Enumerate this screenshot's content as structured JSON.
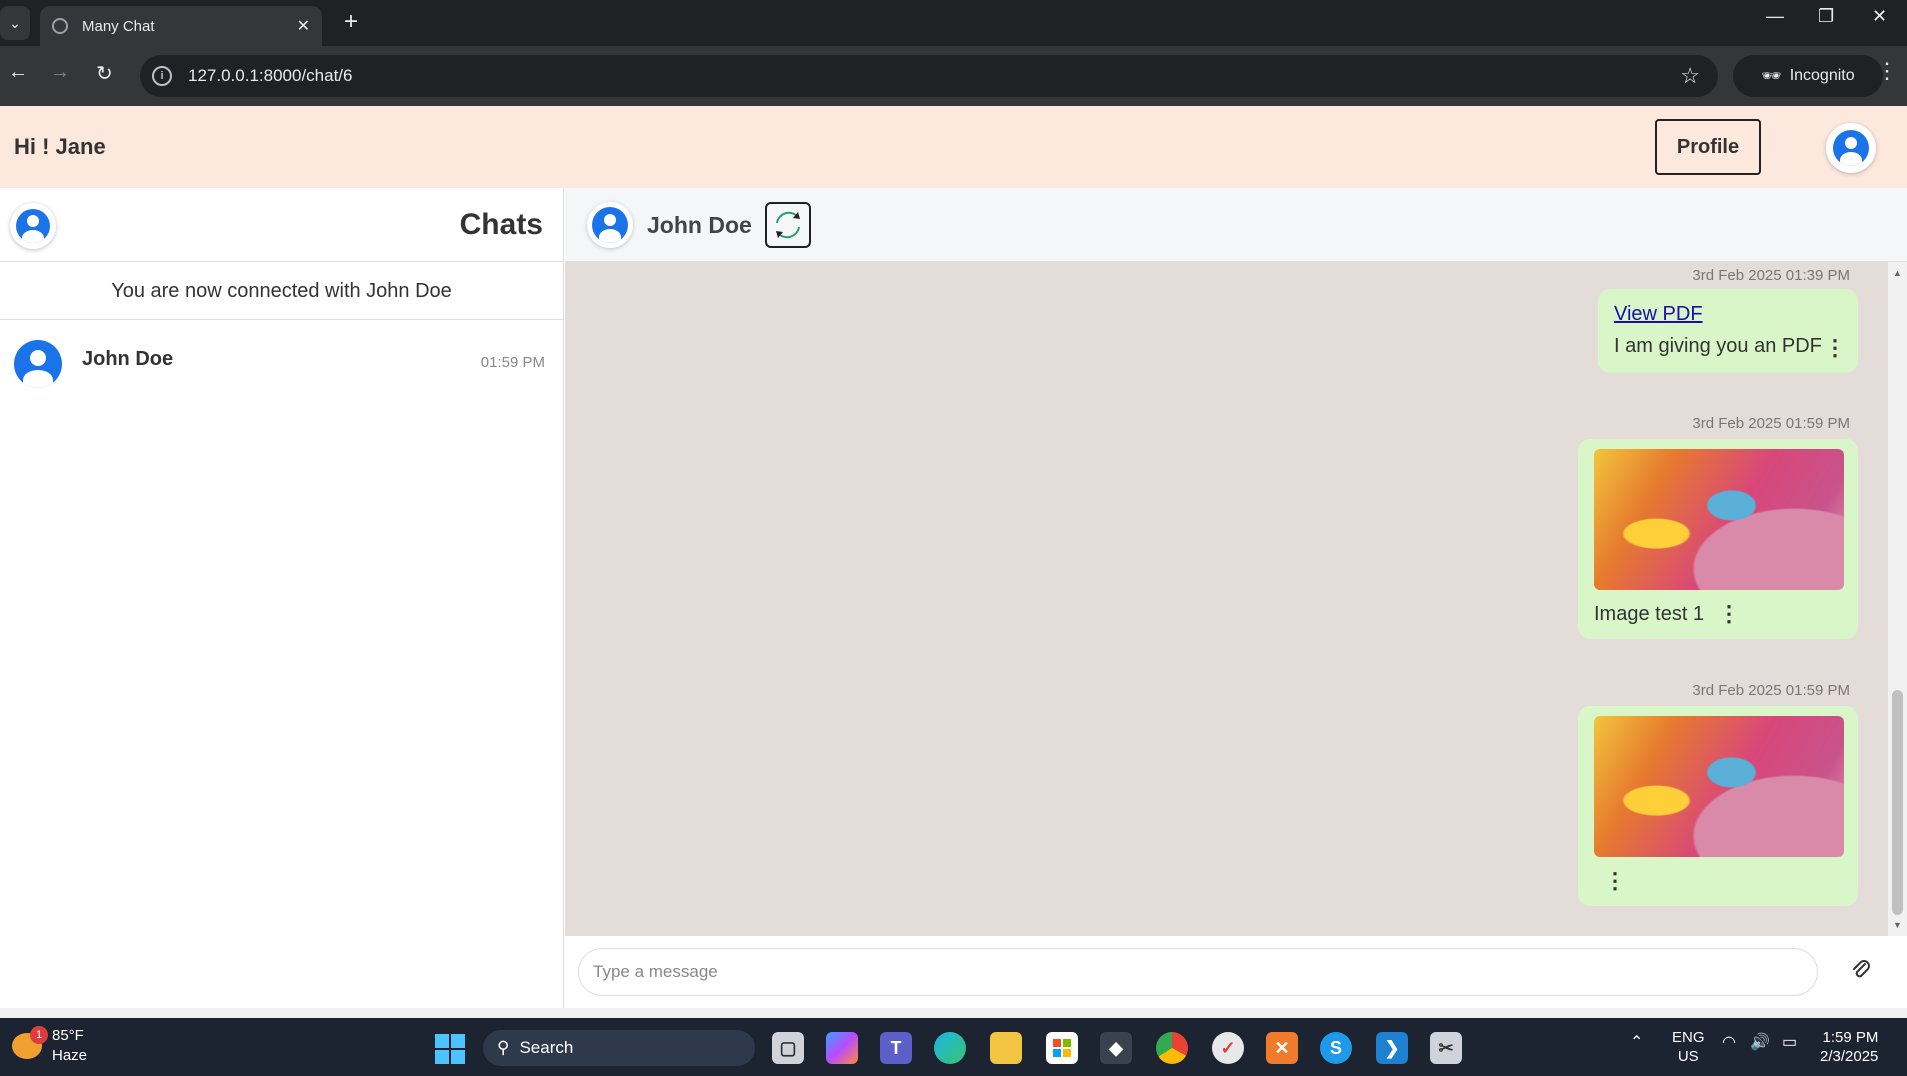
{
  "browser": {
    "tab_title": "Many Chat",
    "url": "127.0.0.1:8000/chat/6",
    "incognito_label": "Incognito"
  },
  "header": {
    "greeting": "Hi ! Jane",
    "profile_label": "Profile"
  },
  "sidebar": {
    "title": "Chats",
    "connected_message": "You are now connected with John Doe",
    "chats": [
      {
        "name": "John Doe",
        "time": "01:59 PM"
      }
    ]
  },
  "chat": {
    "contact_name": "John Doe",
    "messages": [
      {
        "timestamp": "3rd Feb 2025 01:39 PM",
        "link": "View PDF",
        "text": "I am giving you an PDF"
      },
      {
        "timestamp": "3rd Feb 2025 01:59 PM",
        "image": "chameleon",
        "text": "Image test 1"
      },
      {
        "timestamp": "3rd Feb 2025 01:59 PM",
        "image": "chameleon",
        "text": ""
      }
    ],
    "input_placeholder": "Type a message"
  },
  "taskbar": {
    "weather_temp": "85°F",
    "weather_desc": "Haze",
    "weather_badge": "1",
    "search_label": "Search",
    "lang_top": "ENG",
    "lang_bottom": "US",
    "time": "1:59 PM",
    "date": "2/3/2025"
  },
  "colors": {
    "header_bg": "#fde8de",
    "chat_bg": "#e4dcd8",
    "bubble_bg": "#d9f6c8",
    "avatar_blue": "#1a73e8"
  }
}
